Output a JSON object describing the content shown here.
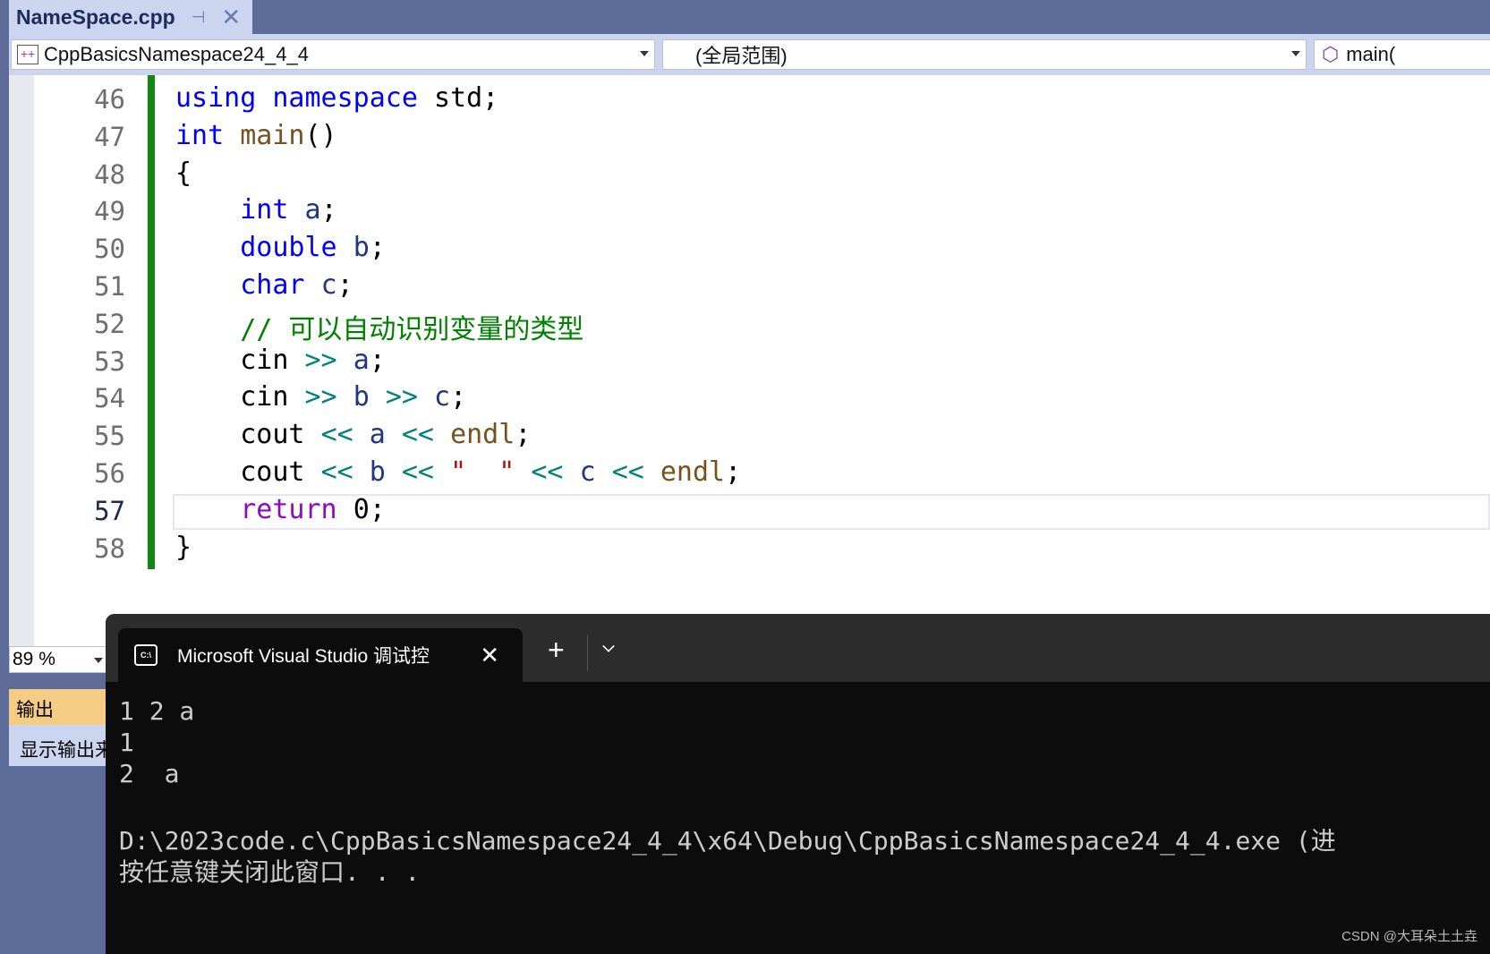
{
  "tab": {
    "title": "NameSpace.cpp",
    "pin": "⊣",
    "close": "✕"
  },
  "nav": {
    "project": "CppBasicsNamespace24_4_4",
    "scope": "(全局范围)",
    "member": "main("
  },
  "editor": {
    "current_line": 57,
    "lines": [
      {
        "n": 46,
        "tokens": [
          [
            "using ",
            "kw"
          ],
          [
            "namespace ",
            "kw"
          ],
          [
            "std;",
            ""
          ]
        ]
      },
      {
        "n": 47,
        "tokens": [
          [
            "int ",
            "kw"
          ],
          [
            "main",
            "fn"
          ],
          [
            "()",
            ""
          ]
        ]
      },
      {
        "n": 48,
        "tokens": [
          [
            "{",
            ""
          ]
        ]
      },
      {
        "n": 49,
        "tokens": [
          [
            "    ",
            ""
          ],
          [
            "int ",
            "kw"
          ],
          [
            "a",
            "var"
          ],
          [
            ";",
            ""
          ]
        ]
      },
      {
        "n": 50,
        "tokens": [
          [
            "    ",
            ""
          ],
          [
            "double ",
            "kw"
          ],
          [
            "b",
            "var"
          ],
          [
            ";",
            ""
          ]
        ]
      },
      {
        "n": 51,
        "tokens": [
          [
            "    ",
            ""
          ],
          [
            "char ",
            "kw"
          ],
          [
            "c",
            "var"
          ],
          [
            ";",
            ""
          ]
        ]
      },
      {
        "n": 52,
        "tokens": [
          [
            "    ",
            ""
          ],
          [
            "// 可以自动识别变量的类型",
            "cm"
          ]
        ]
      },
      {
        "n": 53,
        "tokens": [
          [
            "    cin ",
            ""
          ],
          [
            ">> ",
            "op"
          ],
          [
            "a",
            "var"
          ],
          [
            ";",
            ""
          ]
        ]
      },
      {
        "n": 54,
        "tokens": [
          [
            "    cin ",
            ""
          ],
          [
            ">> ",
            "op"
          ],
          [
            "b ",
            "var"
          ],
          [
            ">> ",
            "op"
          ],
          [
            "c",
            "var"
          ],
          [
            ";",
            ""
          ]
        ]
      },
      {
        "n": 55,
        "tokens": [
          [
            "    cout ",
            ""
          ],
          [
            "<< ",
            "op"
          ],
          [
            "a ",
            "var"
          ],
          [
            "<< ",
            "op"
          ],
          [
            "endl",
            "fn"
          ],
          [
            ";",
            ""
          ]
        ]
      },
      {
        "n": 56,
        "tokens": [
          [
            "    cout ",
            ""
          ],
          [
            "<< ",
            "op"
          ],
          [
            "b ",
            "var"
          ],
          [
            "<< ",
            "op"
          ],
          [
            "\"  \" ",
            "st"
          ],
          [
            "<< ",
            "op"
          ],
          [
            "c ",
            "var"
          ],
          [
            "<< ",
            "op"
          ],
          [
            "endl",
            "fn"
          ],
          [
            ";",
            ""
          ]
        ]
      },
      {
        "n": 57,
        "tokens": [
          [
            "    ",
            ""
          ],
          [
            "return ",
            "rt"
          ],
          [
            "0;",
            ""
          ]
        ]
      },
      {
        "n": 58,
        "tokens": [
          [
            "}",
            ""
          ]
        ]
      }
    ]
  },
  "zoom": "89 %",
  "output_panel": {
    "title": "输出",
    "show_label": "显示输出来"
  },
  "terminal": {
    "tab_title": "Microsoft Visual Studio 调试控",
    "icon": "C:\\",
    "close": "✕",
    "new_tab": "+",
    "lines": [
      "1 2 a",
      "1",
      "2  a",
      "",
      "D:\\2023code.c\\CppBasicsNamespace24_4_4\\x64\\Debug\\CppBasicsNamespace24_4_4.exe (进",
      "按任意键关闭此窗口. . ."
    ]
  },
  "watermark": "CSDN @大耳朵土土垚"
}
